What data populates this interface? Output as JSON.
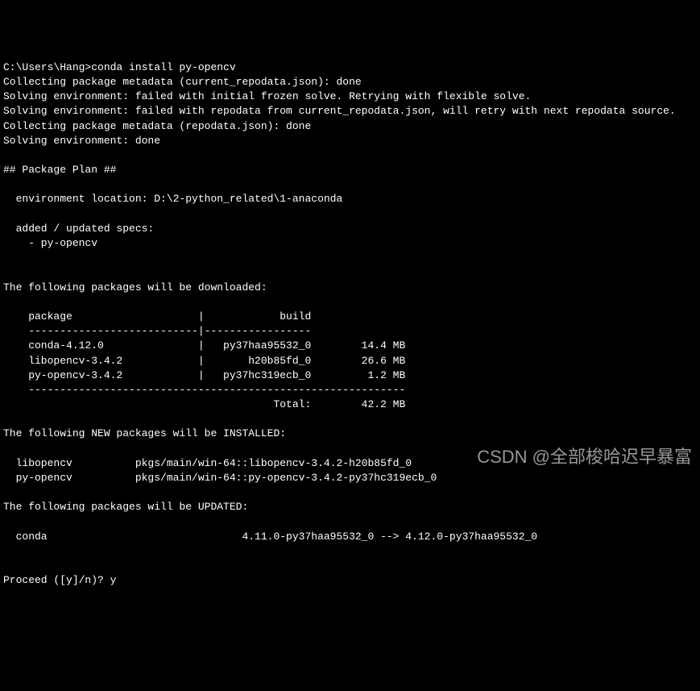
{
  "prompt": {
    "path": "C:\\Users\\Hang>",
    "command": "conda install py-opencv"
  },
  "lines": {
    "l1": "Collecting package metadata (current_repodata.json): done",
    "l2": "Solving environment: failed with initial frozen solve. Retrying with flexible solve.",
    "l3": "Solving environment: failed with repodata from current_repodata.json, will retry with next repodata source.",
    "l4": "Collecting package metadata (repodata.json): done",
    "l5": "Solving environment: done",
    "l6": "",
    "l7": "## Package Plan ##",
    "l8": "",
    "l9": "  environment location: D:\\2-python_related\\1-anaconda",
    "l10": "",
    "l11": "  added / updated specs:",
    "l12": "    - py-opencv",
    "l13": "",
    "l14": "",
    "l15": "The following packages will be downloaded:",
    "l16": "",
    "l17": "    package                    |            build",
    "l18": "    ---------------------------|-----------------",
    "l19": "    conda-4.12.0               |   py37haa95532_0        14.4 MB",
    "l20": "    libopencv-3.4.2            |       h20b85fd_0        26.6 MB",
    "l21": "    py-opencv-3.4.2            |   py37hc319ecb_0         1.2 MB",
    "l22": "    ------------------------------------------------------------",
    "l23": "                                           Total:        42.2 MB",
    "l24": "",
    "l25": "The following NEW packages will be INSTALLED:",
    "l26": "",
    "l27": "  libopencv          pkgs/main/win-64::libopencv-3.4.2-h20b85fd_0",
    "l28": "  py-opencv          pkgs/main/win-64::py-opencv-3.4.2-py37hc319ecb_0",
    "l29": "",
    "l30": "The following packages will be UPDATED:",
    "l31": "",
    "l32": "  conda                               4.11.0-py37haa95532_0 --> 4.12.0-py37haa95532_0",
    "l33": "",
    "l34": ""
  },
  "proceed": {
    "prompt": "Proceed ([y]/n)? ",
    "answer": "y"
  },
  "watermark": "CSDN @全部梭哈迟早暴富",
  "packages_downloaded": [
    {
      "package": "conda-4.12.0",
      "build": "py37haa95532_0",
      "size": "14.4 MB"
    },
    {
      "package": "libopencv-3.4.2",
      "build": "h20b85fd_0",
      "size": "26.6 MB"
    },
    {
      "package": "py-opencv-3.4.2",
      "build": "py37hc319ecb_0",
      "size": "1.2 MB"
    }
  ],
  "total_size": "42.2 MB",
  "new_packages": [
    {
      "name": "libopencv",
      "source": "pkgs/main/win-64::libopencv-3.4.2-h20b85fd_0"
    },
    {
      "name": "py-opencv",
      "source": "pkgs/main/win-64::py-opencv-3.4.2-py37hc319ecb_0"
    }
  ],
  "updated_packages": [
    {
      "name": "conda",
      "from": "4.11.0-py37haa95532_0",
      "to": "4.12.0-py37haa95532_0"
    }
  ]
}
